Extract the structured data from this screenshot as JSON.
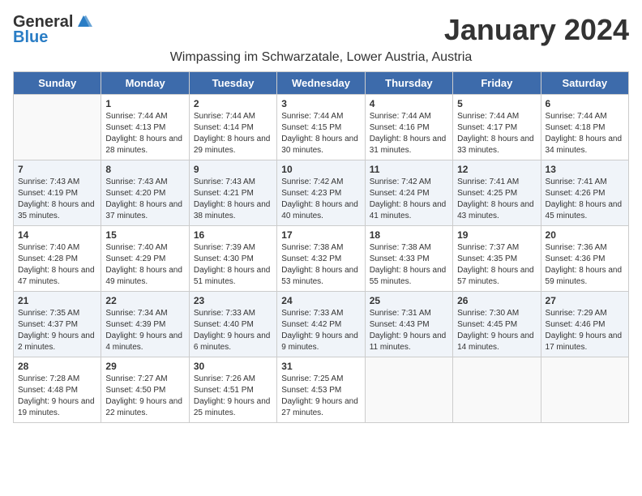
{
  "logo": {
    "general": "General",
    "blue": "Blue"
  },
  "title": "January 2024",
  "location": "Wimpassing im Schwarzatale, Lower Austria, Austria",
  "weekdays": [
    "Sunday",
    "Monday",
    "Tuesday",
    "Wednesday",
    "Thursday",
    "Friday",
    "Saturday"
  ],
  "weeks": [
    {
      "shaded": false,
      "days": [
        {
          "num": "",
          "empty": true
        },
        {
          "num": "1",
          "sunrise": "Sunrise: 7:44 AM",
          "sunset": "Sunset: 4:13 PM",
          "daylight": "Daylight: 8 hours and 28 minutes."
        },
        {
          "num": "2",
          "sunrise": "Sunrise: 7:44 AM",
          "sunset": "Sunset: 4:14 PM",
          "daylight": "Daylight: 8 hours and 29 minutes."
        },
        {
          "num": "3",
          "sunrise": "Sunrise: 7:44 AM",
          "sunset": "Sunset: 4:15 PM",
          "daylight": "Daylight: 8 hours and 30 minutes."
        },
        {
          "num": "4",
          "sunrise": "Sunrise: 7:44 AM",
          "sunset": "Sunset: 4:16 PM",
          "daylight": "Daylight: 8 hours and 31 minutes."
        },
        {
          "num": "5",
          "sunrise": "Sunrise: 7:44 AM",
          "sunset": "Sunset: 4:17 PM",
          "daylight": "Daylight: 8 hours and 33 minutes."
        },
        {
          "num": "6",
          "sunrise": "Sunrise: 7:44 AM",
          "sunset": "Sunset: 4:18 PM",
          "daylight": "Daylight: 8 hours and 34 minutes."
        }
      ]
    },
    {
      "shaded": true,
      "days": [
        {
          "num": "7",
          "sunrise": "Sunrise: 7:43 AM",
          "sunset": "Sunset: 4:19 PM",
          "daylight": "Daylight: 8 hours and 35 minutes."
        },
        {
          "num": "8",
          "sunrise": "Sunrise: 7:43 AM",
          "sunset": "Sunset: 4:20 PM",
          "daylight": "Daylight: 8 hours and 37 minutes."
        },
        {
          "num": "9",
          "sunrise": "Sunrise: 7:43 AM",
          "sunset": "Sunset: 4:21 PM",
          "daylight": "Daylight: 8 hours and 38 minutes."
        },
        {
          "num": "10",
          "sunrise": "Sunrise: 7:42 AM",
          "sunset": "Sunset: 4:23 PM",
          "daylight": "Daylight: 8 hours and 40 minutes."
        },
        {
          "num": "11",
          "sunrise": "Sunrise: 7:42 AM",
          "sunset": "Sunset: 4:24 PM",
          "daylight": "Daylight: 8 hours and 41 minutes."
        },
        {
          "num": "12",
          "sunrise": "Sunrise: 7:41 AM",
          "sunset": "Sunset: 4:25 PM",
          "daylight": "Daylight: 8 hours and 43 minutes."
        },
        {
          "num": "13",
          "sunrise": "Sunrise: 7:41 AM",
          "sunset": "Sunset: 4:26 PM",
          "daylight": "Daylight: 8 hours and 45 minutes."
        }
      ]
    },
    {
      "shaded": false,
      "days": [
        {
          "num": "14",
          "sunrise": "Sunrise: 7:40 AM",
          "sunset": "Sunset: 4:28 PM",
          "daylight": "Daylight: 8 hours and 47 minutes."
        },
        {
          "num": "15",
          "sunrise": "Sunrise: 7:40 AM",
          "sunset": "Sunset: 4:29 PM",
          "daylight": "Daylight: 8 hours and 49 minutes."
        },
        {
          "num": "16",
          "sunrise": "Sunrise: 7:39 AM",
          "sunset": "Sunset: 4:30 PM",
          "daylight": "Daylight: 8 hours and 51 minutes."
        },
        {
          "num": "17",
          "sunrise": "Sunrise: 7:38 AM",
          "sunset": "Sunset: 4:32 PM",
          "daylight": "Daylight: 8 hours and 53 minutes."
        },
        {
          "num": "18",
          "sunrise": "Sunrise: 7:38 AM",
          "sunset": "Sunset: 4:33 PM",
          "daylight": "Daylight: 8 hours and 55 minutes."
        },
        {
          "num": "19",
          "sunrise": "Sunrise: 7:37 AM",
          "sunset": "Sunset: 4:35 PM",
          "daylight": "Daylight: 8 hours and 57 minutes."
        },
        {
          "num": "20",
          "sunrise": "Sunrise: 7:36 AM",
          "sunset": "Sunset: 4:36 PM",
          "daylight": "Daylight: 8 hours and 59 minutes."
        }
      ]
    },
    {
      "shaded": true,
      "days": [
        {
          "num": "21",
          "sunrise": "Sunrise: 7:35 AM",
          "sunset": "Sunset: 4:37 PM",
          "daylight": "Daylight: 9 hours and 2 minutes."
        },
        {
          "num": "22",
          "sunrise": "Sunrise: 7:34 AM",
          "sunset": "Sunset: 4:39 PM",
          "daylight": "Daylight: 9 hours and 4 minutes."
        },
        {
          "num": "23",
          "sunrise": "Sunrise: 7:33 AM",
          "sunset": "Sunset: 4:40 PM",
          "daylight": "Daylight: 9 hours and 6 minutes."
        },
        {
          "num": "24",
          "sunrise": "Sunrise: 7:33 AM",
          "sunset": "Sunset: 4:42 PM",
          "daylight": "Daylight: 9 hours and 9 minutes."
        },
        {
          "num": "25",
          "sunrise": "Sunrise: 7:31 AM",
          "sunset": "Sunset: 4:43 PM",
          "daylight": "Daylight: 9 hours and 11 minutes."
        },
        {
          "num": "26",
          "sunrise": "Sunrise: 7:30 AM",
          "sunset": "Sunset: 4:45 PM",
          "daylight": "Daylight: 9 hours and 14 minutes."
        },
        {
          "num": "27",
          "sunrise": "Sunrise: 7:29 AM",
          "sunset": "Sunset: 4:46 PM",
          "daylight": "Daylight: 9 hours and 17 minutes."
        }
      ]
    },
    {
      "shaded": false,
      "days": [
        {
          "num": "28",
          "sunrise": "Sunrise: 7:28 AM",
          "sunset": "Sunset: 4:48 PM",
          "daylight": "Daylight: 9 hours and 19 minutes."
        },
        {
          "num": "29",
          "sunrise": "Sunrise: 7:27 AM",
          "sunset": "Sunset: 4:50 PM",
          "daylight": "Daylight: 9 hours and 22 minutes."
        },
        {
          "num": "30",
          "sunrise": "Sunrise: 7:26 AM",
          "sunset": "Sunset: 4:51 PM",
          "daylight": "Daylight: 9 hours and 25 minutes."
        },
        {
          "num": "31",
          "sunrise": "Sunrise: 7:25 AM",
          "sunset": "Sunset: 4:53 PM",
          "daylight": "Daylight: 9 hours and 27 minutes."
        },
        {
          "num": "",
          "empty": true
        },
        {
          "num": "",
          "empty": true
        },
        {
          "num": "",
          "empty": true
        }
      ]
    }
  ]
}
